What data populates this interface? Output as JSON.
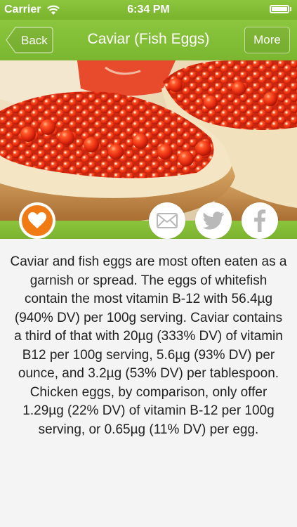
{
  "status_bar": {
    "carrier": "Carrier",
    "time": "6:34 PM",
    "icons": [
      "wifi-icon",
      "battery-icon"
    ]
  },
  "nav": {
    "back_label": "Back",
    "title": "Caviar (Fish Eggs)",
    "more_label": "More"
  },
  "actions": {
    "icons": [
      "heart-icon",
      "mail-icon",
      "twitter-icon",
      "facebook-icon"
    ]
  },
  "content": {
    "description": "Caviar and fish eggs are most often eaten as a garnish or spread. The eggs of whitefish contain the most vitamin B-12 with 56.4µg (940% DV) per 100g serving. Caviar contains a third of that with 20µg (333% DV) of vitamin B12 per 100g serving, 5.6µg (93% DV) per ounce, and 3.2µg (53% DV) per tablespoon. Chicken eggs, by comparison, only offer 1.29µg (22% DV) of vitamin B-12 per 100g serving, or 0.65µg (11% DV) per egg."
  },
  "colors": {
    "brand_green": "#8cc63f",
    "heart_orange": "#f07b14",
    "share_icon_gray": "#b9b9b9"
  }
}
